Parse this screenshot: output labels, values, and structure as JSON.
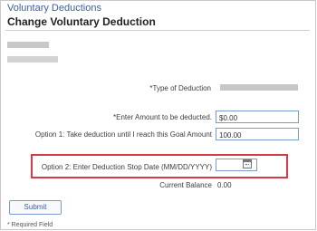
{
  "page": {
    "breadcrumb": "Voluntary Deductions",
    "title": "Change Voluntary Deduction",
    "required_note": "* Required Field"
  },
  "form": {
    "type_label": "*Type of Deduction",
    "amount_label": "*Enter Amount to be deducted.",
    "amount_value": "$0.00",
    "goal_label": "Option 1: Take deduction until I reach this Goal Amount",
    "goal_value": "100.00",
    "stop_date_label": "Option 2: Enter Deduction Stop Date (MM/DD/YYYY)",
    "stop_date_value": "",
    "balance_label": "Current Balance",
    "balance_value": "0.00",
    "submit_label": "Submit"
  },
  "icons": {
    "calendar": "calendar-icon"
  },
  "colors": {
    "link_blue": "#3a5fa0",
    "highlight_red": "#d63a44",
    "input_border": "#7a9cc8"
  }
}
